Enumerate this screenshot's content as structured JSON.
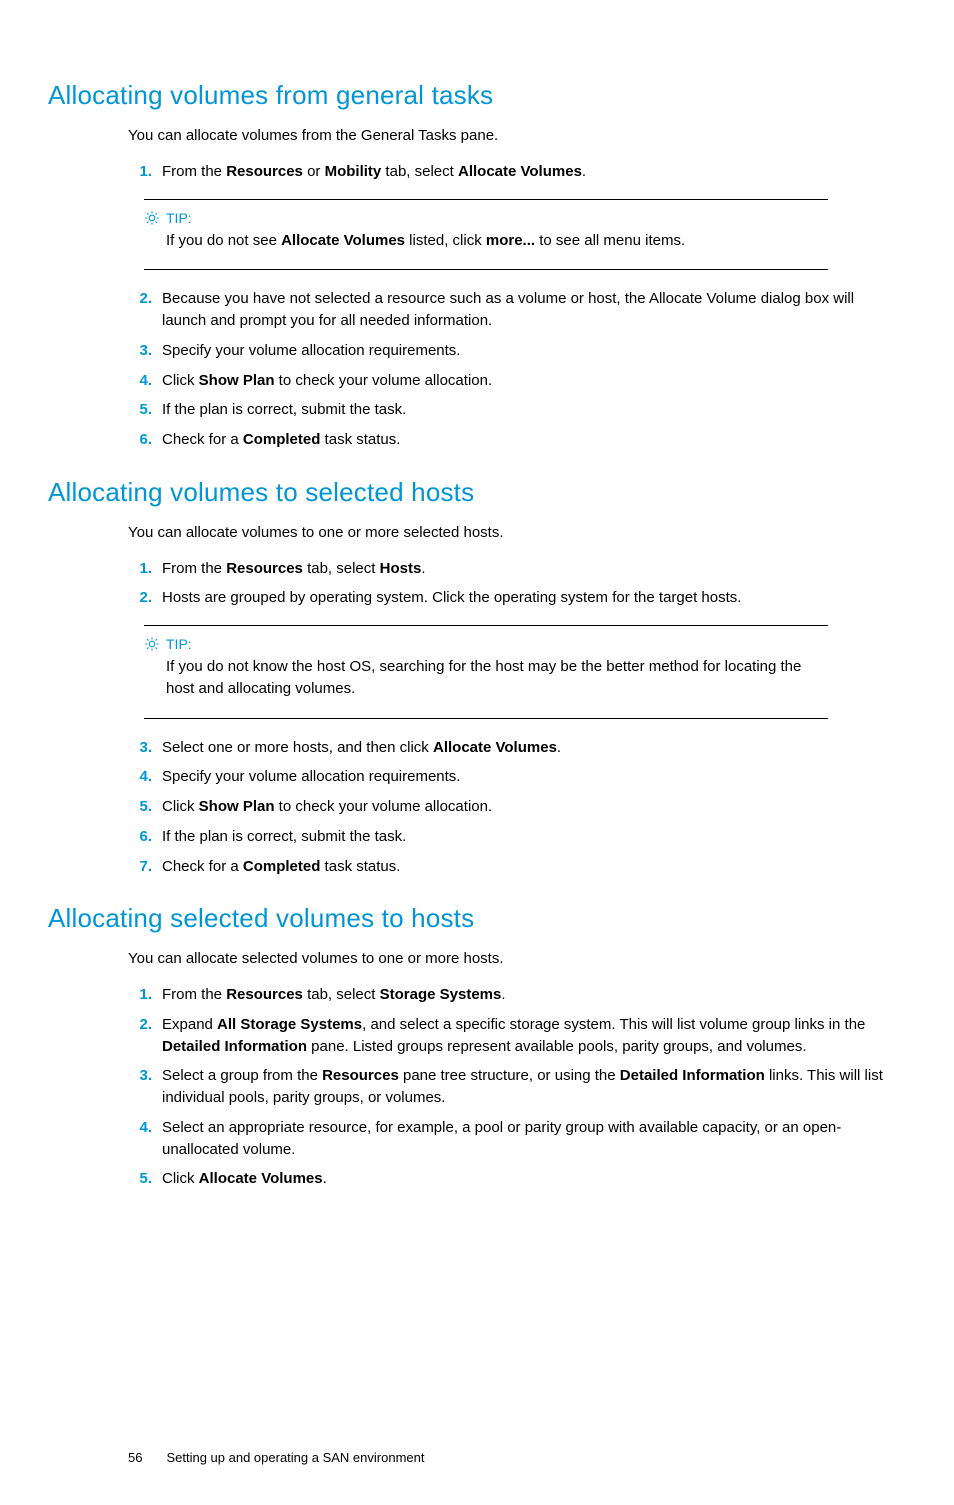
{
  "sections": [
    {
      "heading": "Allocating volumes from general tasks",
      "intro": "You can allocate volumes from the General Tasks pane.",
      "blocks": [
        {
          "type": "step",
          "num": "1.",
          "html": "From the <b>Resources</b> or <b>Mobility</b> tab, select <b>Allocate Volumes</b>."
        },
        {
          "type": "tip",
          "label": "TIP:",
          "html": "If you do not see <b>Allocate Volumes</b> listed, click <b>more...</b> to see all menu items."
        },
        {
          "type": "step",
          "num": "2.",
          "html": "Because you have not selected a resource such as a volume or host, the Allocate Volume dialog box will launch and prompt you for all needed information."
        },
        {
          "type": "step",
          "num": "3.",
          "html": "Specify your volume allocation requirements."
        },
        {
          "type": "step",
          "num": "4.",
          "html": "Click <b>Show Plan</b> to check your volume allocation."
        },
        {
          "type": "step",
          "num": "5.",
          "html": "If the plan is correct, submit the task."
        },
        {
          "type": "step",
          "num": "6.",
          "html": "Check for a <b>Completed</b> task status."
        }
      ]
    },
    {
      "heading": "Allocating volumes to selected hosts",
      "intro": "You can allocate volumes to one or more selected hosts.",
      "blocks": [
        {
          "type": "step",
          "num": "1.",
          "html": "From the <b>Resources</b> tab, select <b>Hosts</b>."
        },
        {
          "type": "step",
          "num": "2.",
          "html": "Hosts are grouped by operating system. Click the operating system for the target hosts."
        },
        {
          "type": "tip",
          "label": "TIP:",
          "html": "If you do not know the host OS, searching for the host may be the better method for locating the host and allocating volumes."
        },
        {
          "type": "step",
          "num": "3.",
          "html": "Select one or more hosts, and then click <b>Allocate Volumes</b>."
        },
        {
          "type": "step",
          "num": "4.",
          "html": "Specify your volume allocation requirements."
        },
        {
          "type": "step",
          "num": "5.",
          "html": "Click <b>Show Plan</b> to check your volume allocation."
        },
        {
          "type": "step",
          "num": "6.",
          "html": "If the plan is correct, submit the task."
        },
        {
          "type": "step",
          "num": "7.",
          "html": "Check for a <b>Completed</b> task status."
        }
      ]
    },
    {
      "heading": "Allocating selected volumes to hosts",
      "intro": "You can allocate selected volumes to one or more hosts.",
      "blocks": [
        {
          "type": "step",
          "num": "1.",
          "html": "From the <b>Resources</b> tab, select <b>Storage Systems</b>."
        },
        {
          "type": "step",
          "num": "2.",
          "html": "Expand <b>All Storage Systems</b>, and select a specific storage system. This will list volume group links in the <b>Detailed Information</b> pane. Listed groups represent available pools, parity groups, and volumes."
        },
        {
          "type": "step",
          "num": "3.",
          "html": "Select a group from the <b>Resources</b> pane tree structure, or using the <b>Detailed Information</b> links. This will list individual pools, parity groups, or volumes."
        },
        {
          "type": "step",
          "num": "4.",
          "html": "Select an appropriate resource, for example, a pool or parity group with available capacity, or an open-unallocated volume."
        },
        {
          "type": "step",
          "num": "5.",
          "html": "Click <b>Allocate Volumes</b>."
        }
      ]
    }
  ],
  "footer": {
    "page_number": "56",
    "chapter": "Setting up and operating a SAN environment"
  }
}
